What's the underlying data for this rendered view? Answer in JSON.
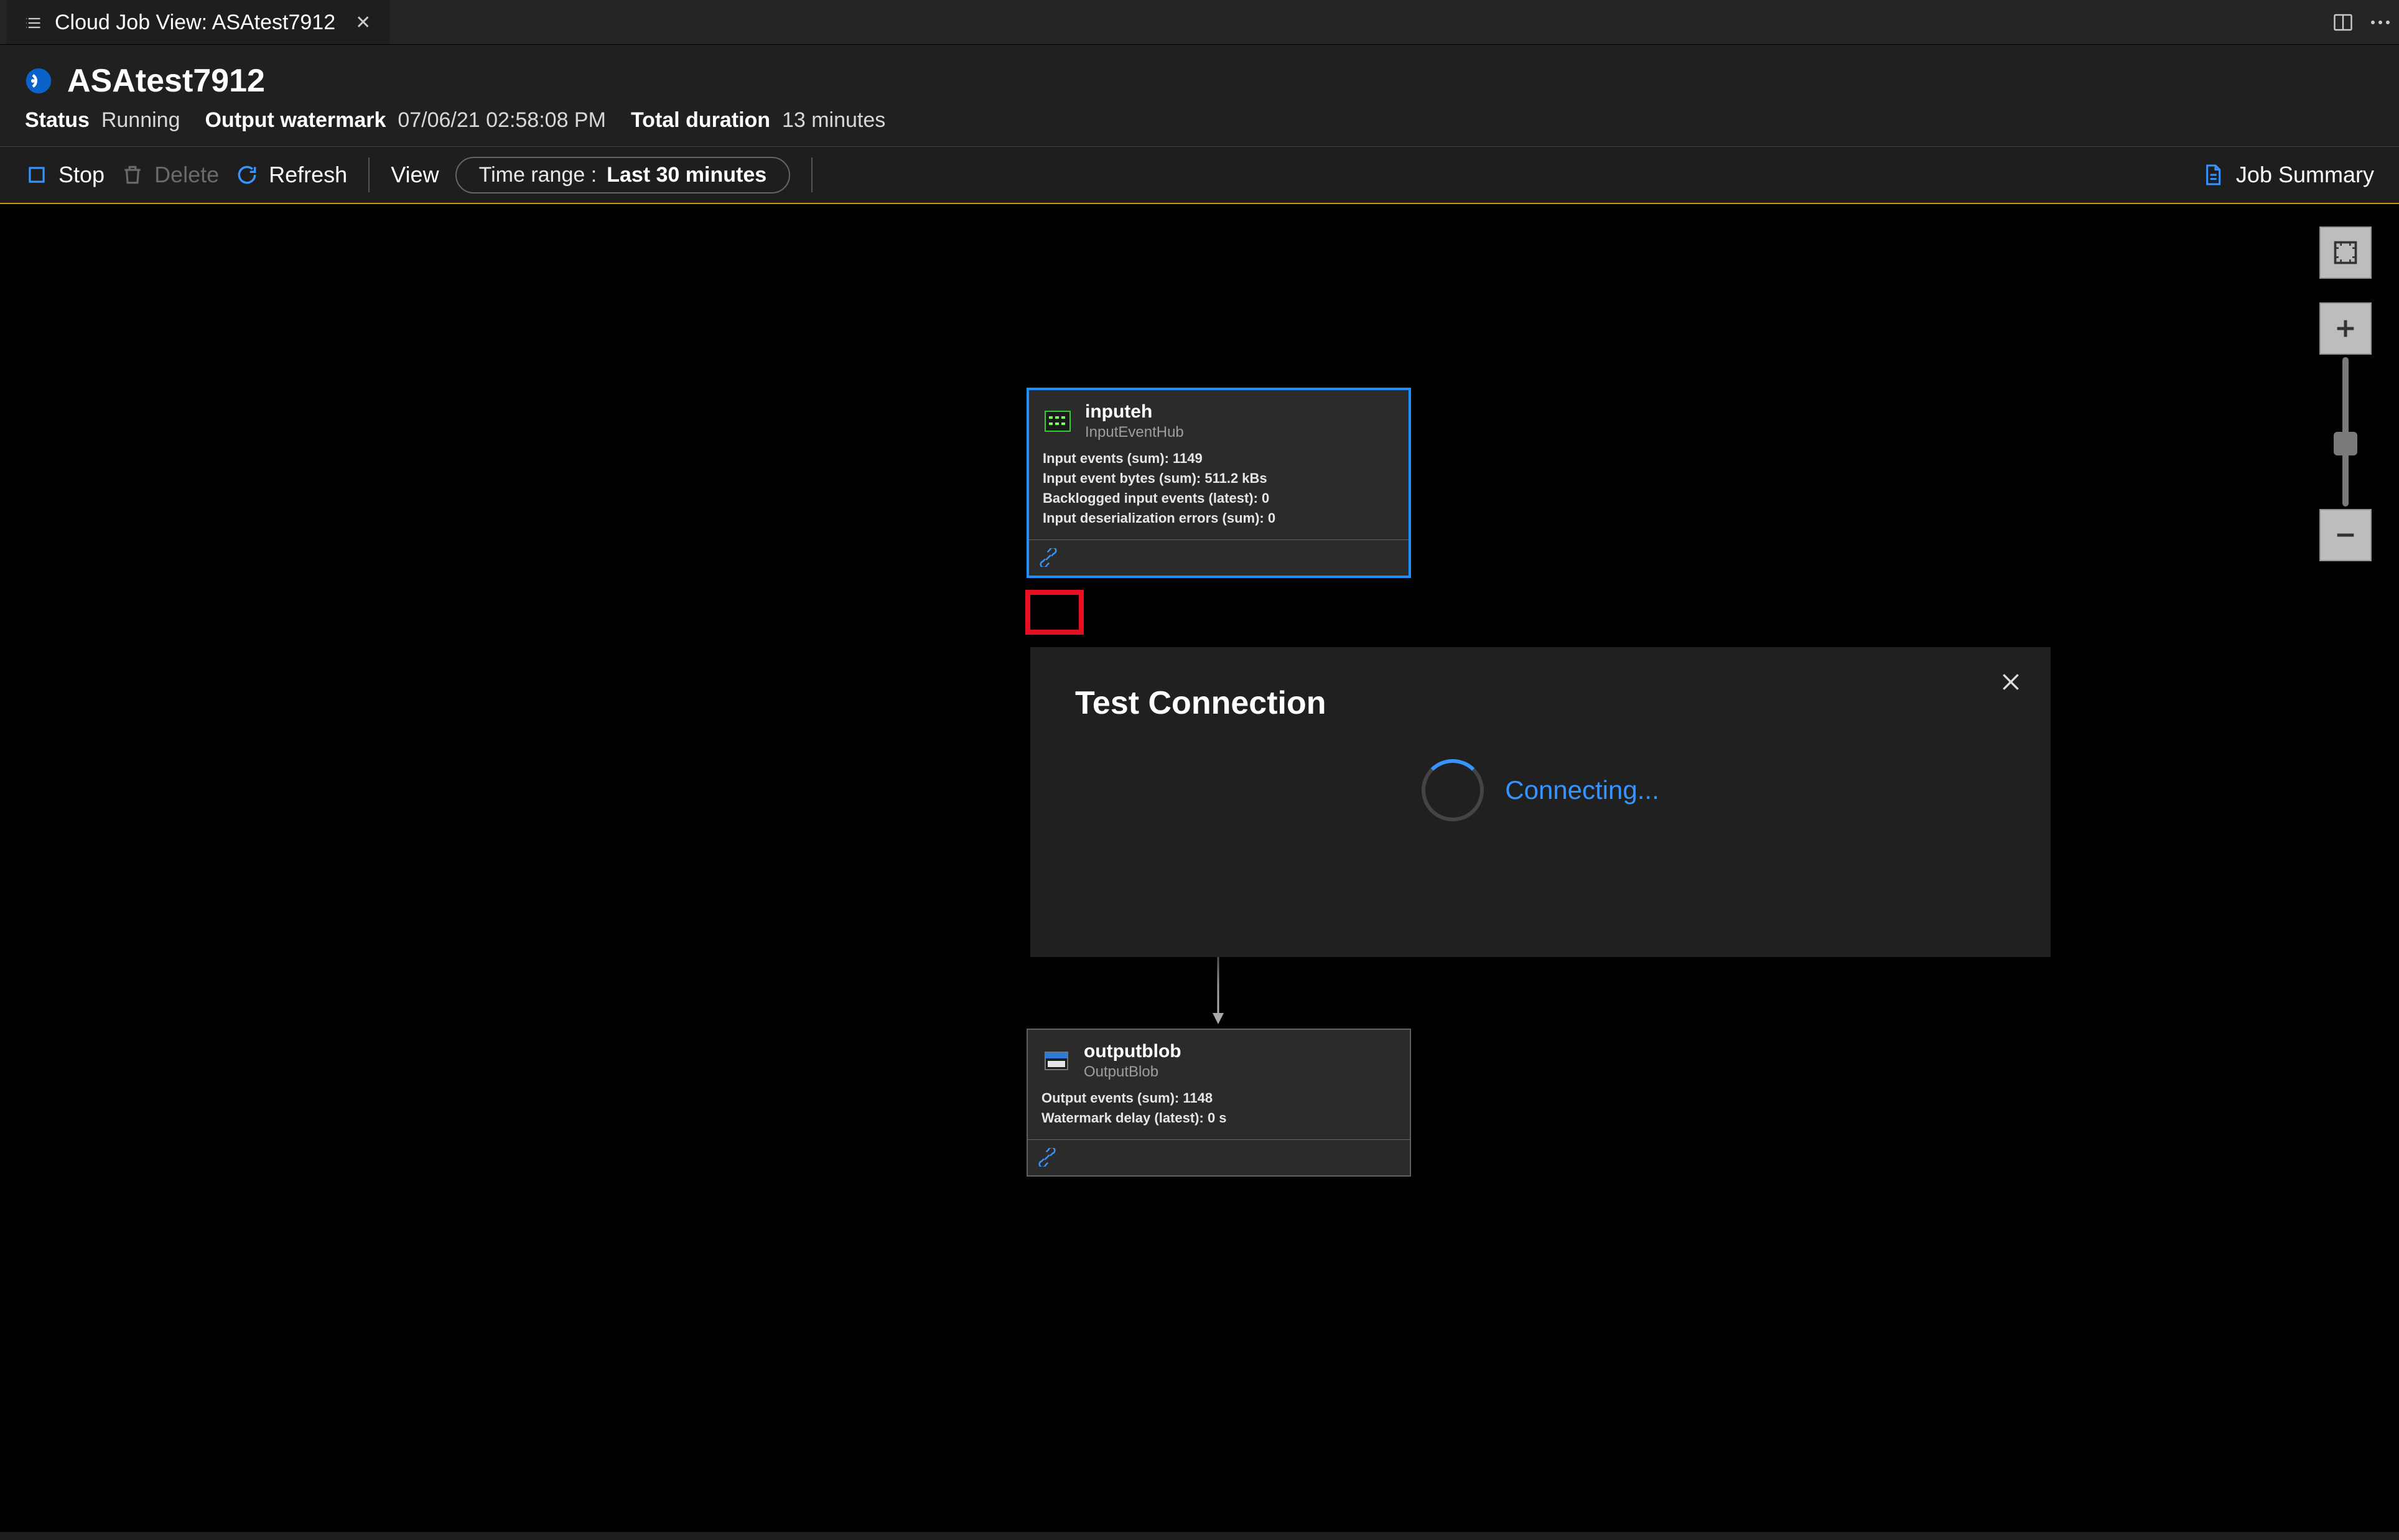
{
  "tab": {
    "title": "Cloud Job View: ASAtest7912"
  },
  "header": {
    "title": "ASAtest7912",
    "status_label": "Status",
    "status_value": "Running",
    "watermark_label": "Output watermark",
    "watermark_value": "07/06/21 02:58:08 PM",
    "duration_label": "Total duration",
    "duration_value": "13 minutes"
  },
  "toolbar": {
    "stop": "Stop",
    "delete": "Delete",
    "refresh": "Refresh",
    "view": "View",
    "time_range_label": "Time range :",
    "time_range_value": "Last 30 minutes",
    "job_summary": "Job Summary"
  },
  "nodes": {
    "input": {
      "name": "inputeh",
      "type": "InputEventHub",
      "metrics": [
        "Input events (sum): 1149",
        "Input event bytes (sum): 511.2 kBs",
        "Backlogged input events (latest): 0",
        "Input deserialization errors (sum): 0"
      ]
    },
    "output": {
      "name": "outputblob",
      "type": "OutputBlob",
      "metrics": [
        "Output events (sum): 1148",
        "Watermark delay (latest): 0 s"
      ]
    }
  },
  "dialog": {
    "title": "Test Connection",
    "status": "Connecting..."
  },
  "icons": {
    "tab": "list-icon",
    "azure": "azure-stream-icon",
    "stop": "stop-icon",
    "delete": "trash-icon",
    "refresh": "refresh-icon",
    "summary": "document-icon",
    "plug": "plug-icon",
    "fit": "fit-screen-icon",
    "plus": "plus-icon",
    "minus": "minus-icon",
    "split": "split-editor-icon",
    "more": "more-icon",
    "close": "close-icon"
  }
}
